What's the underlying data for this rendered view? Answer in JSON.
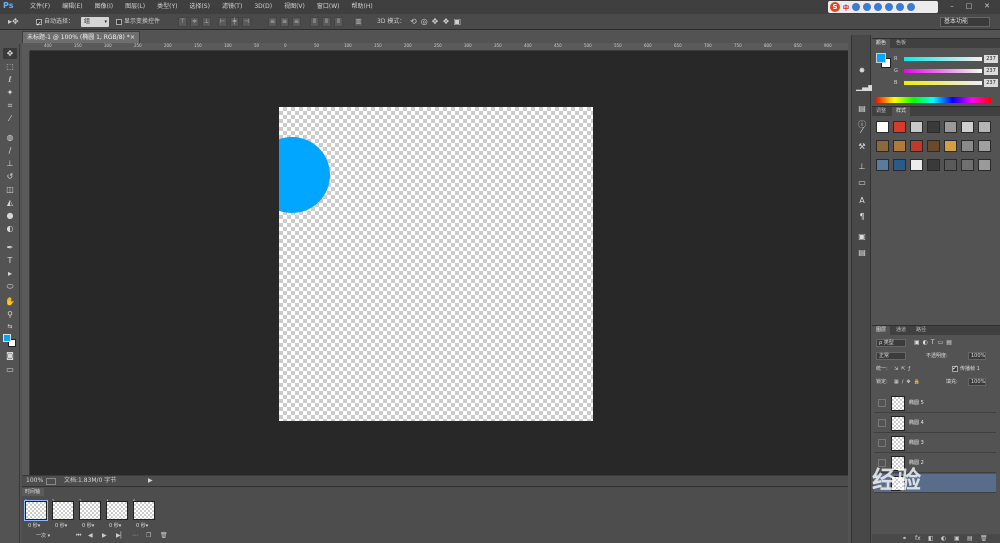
{
  "app": {
    "logo": "Ps"
  },
  "menu": [
    "文件(F)",
    "编辑(E)",
    "图像(I)",
    "图层(L)",
    "类型(Y)",
    "选择(S)",
    "滤镜(T)",
    "3D(D)",
    "视图(V)",
    "窗口(W)",
    "帮助(H)"
  ],
  "tray": {
    "logo": "S",
    "lang": "中"
  },
  "window_controls": {
    "minimize": "–",
    "maximize": "□",
    "close": "✕"
  },
  "options": {
    "auto_select_label": "自动选择：",
    "auto_select_value": "组",
    "show_transform_label": "显示变换控件",
    "mode_3d_label": "3D 模式：",
    "workspace": "基本功能"
  },
  "document": {
    "tab_title": "未标题-1 @ 100% (椭圆 1, RGB/8) *",
    "tab_close": "×",
    "shape_color": "#00a6ff",
    "ruler_labels": [
      "400",
      "350",
      "300",
      "250",
      "200",
      "150",
      "100",
      "50",
      "0",
      "50",
      "100",
      "150",
      "200",
      "250",
      "300",
      "350",
      "400",
      "450",
      "500",
      "550",
      "600",
      "650",
      "700",
      "750",
      "800",
      "850",
      "900"
    ]
  },
  "status": {
    "zoom": "100%",
    "doc_info": "文档:1.83M/0 字节",
    "arrow": "▶"
  },
  "timeline": {
    "tab": "时间轴",
    "frames": [
      {
        "num": "1",
        "dur": "0 秒▾"
      },
      {
        "num": "2",
        "dur": "0 秒▾"
      },
      {
        "num": "3",
        "dur": "0 秒▾"
      },
      {
        "num": "4",
        "dur": "0 秒▾"
      },
      {
        "num": "5",
        "dur": "0 秒▾"
      }
    ],
    "loop": "一次 ▾"
  },
  "color_panel": {
    "tabs": [
      "颜色",
      "色板"
    ],
    "fg_color": "#00a6ff",
    "rows": [
      {
        "label": "R",
        "value": "237"
      },
      {
        "label": "G",
        "value": "237"
      },
      {
        "label": "B",
        "value": "237"
      }
    ]
  },
  "styles_panel": {
    "tabs": [
      "调整",
      "样式"
    ],
    "swatches": [
      "#ffffff",
      "#d83b2a",
      "#c8c8c8",
      "#3a3a3a",
      "#9a9a9a",
      "#cfcfcf",
      "#b5b5b5",
      "#8a6a3a",
      "#b07a3a",
      "#c0392b",
      "#6a4a2a",
      "#d4a040",
      "#8a8a8a",
      "#a0a0a0",
      "#5a7aa0",
      "#2a5a8a",
      "#ececec",
      "#3a3a3a",
      "#5a5a5a",
      "#707070",
      "#9a9a9a"
    ]
  },
  "layers_panel": {
    "tabs": [
      "图层",
      "通道",
      "路径"
    ],
    "filter_label": "ρ 类型",
    "blend_mode": "正常",
    "opacity_label": "不透明度:",
    "opacity_value": "100%",
    "unify_label": "统一:",
    "propagate_label": "传播帧 1",
    "lock_label": "锁定:",
    "fill_label": "填充:",
    "fill_value": "100%",
    "layers": [
      {
        "name": "椭圆 5",
        "selected": false
      },
      {
        "name": "椭圆 4",
        "selected": false
      },
      {
        "name": "椭圆 3",
        "selected": false
      },
      {
        "name": "椭圆 2",
        "selected": false
      },
      {
        "name": "",
        "selected": true
      }
    ],
    "footer_icons": [
      "⚭",
      "fx",
      "◧",
      "◐",
      "▣",
      "▤",
      "🗑"
    ]
  },
  "watermark": "经验"
}
